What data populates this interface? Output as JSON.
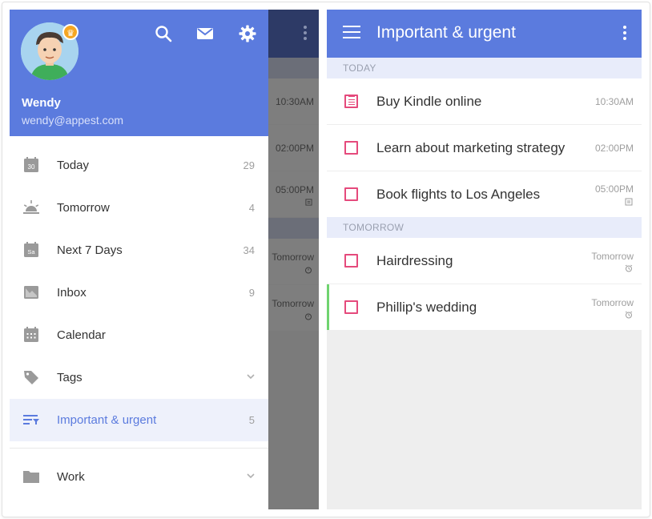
{
  "drawer": {
    "user": {
      "name": "Wendy",
      "email": "wendy@appest.com"
    },
    "header_icons": [
      "search-icon",
      "mail-icon",
      "settings-icon"
    ],
    "items": [
      {
        "id": "today",
        "label": "Today",
        "count": "29",
        "icon": "calendar-day-icon",
        "icon_text": "30"
      },
      {
        "id": "tomorrow",
        "label": "Tomorrow",
        "count": "4",
        "icon": "sunrise-icon"
      },
      {
        "id": "next7",
        "label": "Next 7 Days",
        "count": "34",
        "icon": "calendar-week-icon",
        "icon_text": "Sa"
      },
      {
        "id": "inbox",
        "label": "Inbox",
        "count": "9",
        "icon": "inbox-icon"
      },
      {
        "id": "calendar",
        "label": "Calendar",
        "count": "",
        "icon": "calendar-grid-icon"
      },
      {
        "id": "tags",
        "label": "Tags",
        "count": "",
        "icon": "tag-icon",
        "expandable": true
      },
      {
        "id": "important",
        "label": "Important & urgent",
        "count": "5",
        "icon": "filter-icon",
        "active": true
      }
    ],
    "folders": [
      {
        "id": "work",
        "label": "Work",
        "icon": "folder-icon",
        "expandable": true
      }
    ]
  },
  "background_list": {
    "times": [
      "10:30AM",
      "02:00PM",
      "05:00PM",
      "Tomorrow",
      "Tomorrow"
    ]
  },
  "main": {
    "title": "Important & urgent",
    "sections": [
      {
        "header": "TODAY",
        "tasks": [
          {
            "title": "Buy Kindle online",
            "time": "10:30AM",
            "has_note": true,
            "indicator": ""
          },
          {
            "title": "Learn about marketing strategy",
            "time": "02:00PM",
            "has_note": false,
            "indicator": ""
          },
          {
            "title": "Book flights to Los Angeles",
            "time": "05:00PM",
            "has_note": false,
            "indicator": "note-icon"
          }
        ]
      },
      {
        "header": "TOMORROW",
        "tasks": [
          {
            "title": "Hairdressing",
            "time": "Tomorrow",
            "has_note": false,
            "indicator": "alarm-icon"
          },
          {
            "title": "Phillip's wedding",
            "time": "Tomorrow",
            "has_note": false,
            "indicator": "alarm-icon",
            "accent": true
          }
        ]
      }
    ]
  },
  "colors": {
    "primary": "#5b7bde",
    "checkbox": "#e54a7c",
    "accent_bar": "#6fd46f",
    "section_bg": "#e8ecfa"
  }
}
